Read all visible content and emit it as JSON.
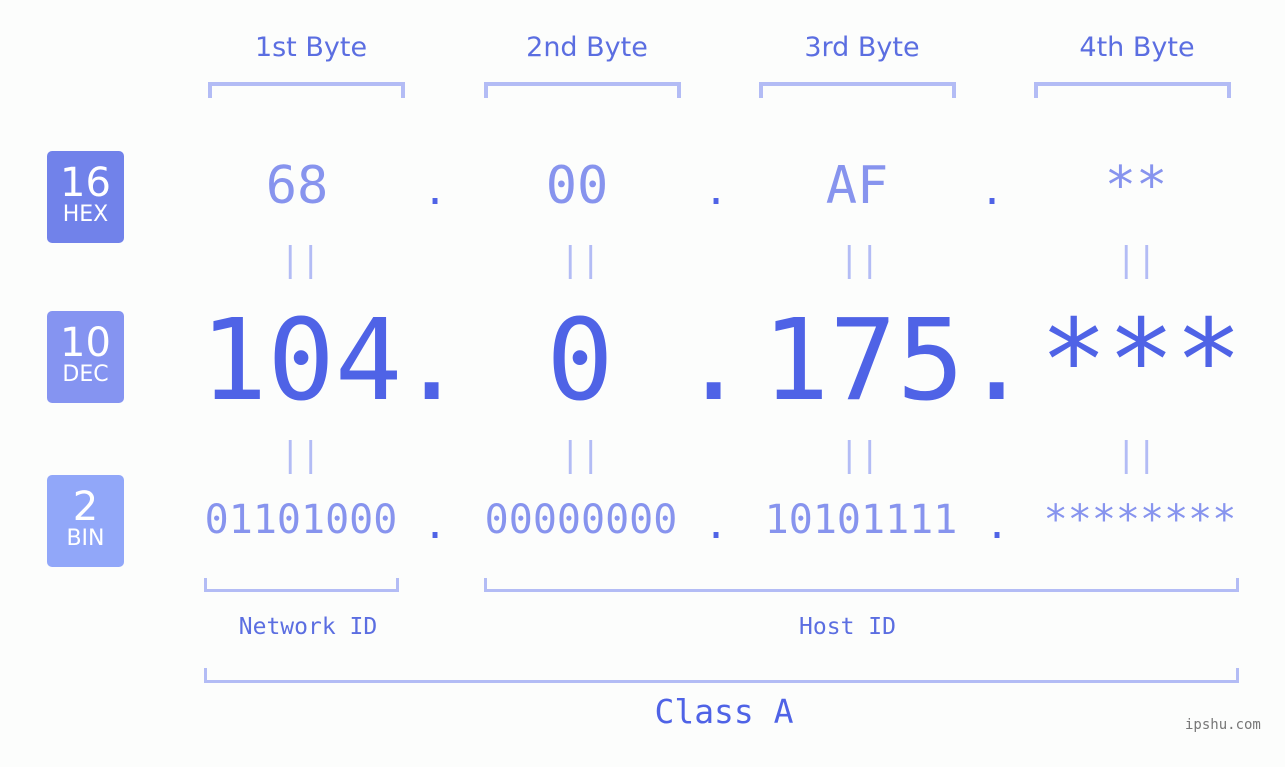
{
  "badges": [
    {
      "num": "16",
      "label": "HEX",
      "color": "#7182ea"
    },
    {
      "num": "10",
      "label": "DEC",
      "color": "#8594f1"
    },
    {
      "num": "2",
      "label": "BIN",
      "color": "#91a7f9"
    }
  ],
  "byte_labels": [
    "1st Byte",
    "2nd Byte",
    "3rd Byte",
    "4th Byte"
  ],
  "hex": [
    "68",
    "00",
    "AF",
    "**"
  ],
  "dec": [
    "104",
    "0",
    "175",
    "***"
  ],
  "bin": [
    "01101000",
    "00000000",
    "10101111",
    "********"
  ],
  "separator": ".",
  "equals": "||",
  "network_id_label": "Network ID",
  "host_id_label": "Host ID",
  "class_label": "Class A",
  "watermark": "ipshu.com",
  "colors": {
    "accent": "#4f63e6",
    "light": "#b3bcf5",
    "mid": "#8794ee"
  }
}
